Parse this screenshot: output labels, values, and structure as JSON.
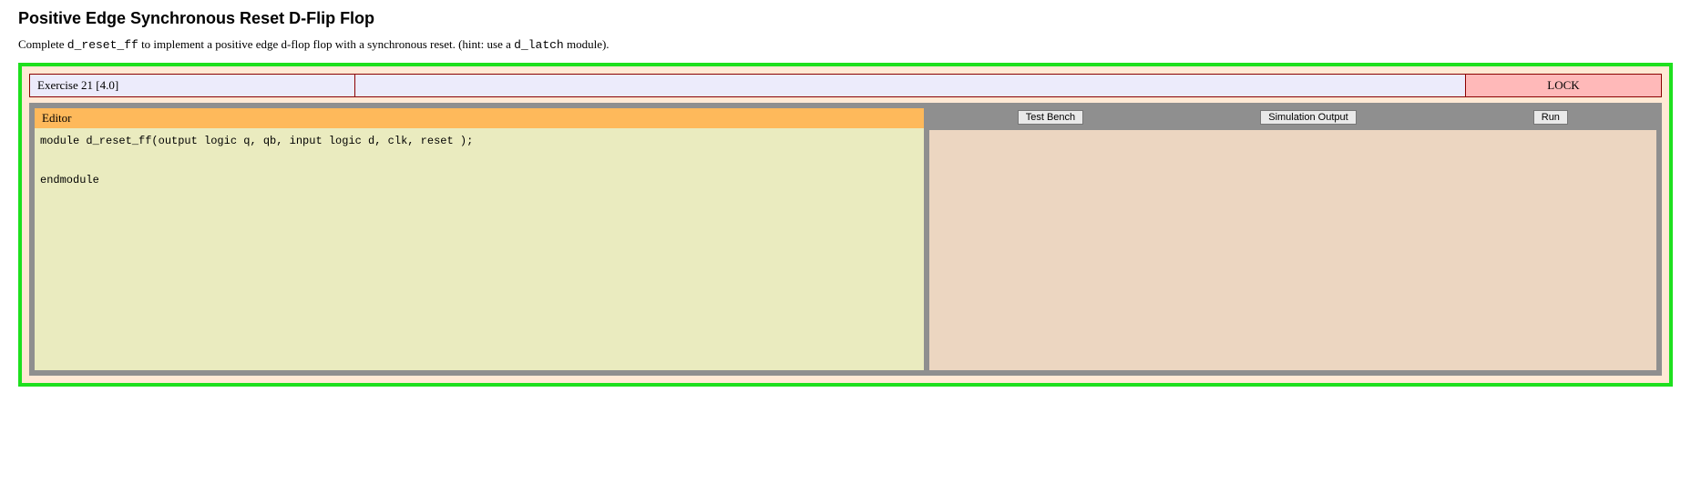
{
  "title": "Positive Edge Synchronous Reset D-Flip Flop",
  "instructions_prefix": "Complete ",
  "instructions_code1": "d_reset_ff",
  "instructions_mid": " to implement a positive edge d-flop flop with a synchronous reset. (hint: use a ",
  "instructions_code2": "d_latch",
  "instructions_suffix": " module).",
  "exercise_label": "Exercise 21 [4.0]",
  "lock_label": "LOCK",
  "editor_header": "Editor",
  "editor_content": "module d_reset_ff(output logic q, qb, input logic d, clk, reset );\n\nendmodule",
  "buttons": {
    "test_bench": "Test Bench",
    "simulation_output": "Simulation Output",
    "run": "Run"
  }
}
